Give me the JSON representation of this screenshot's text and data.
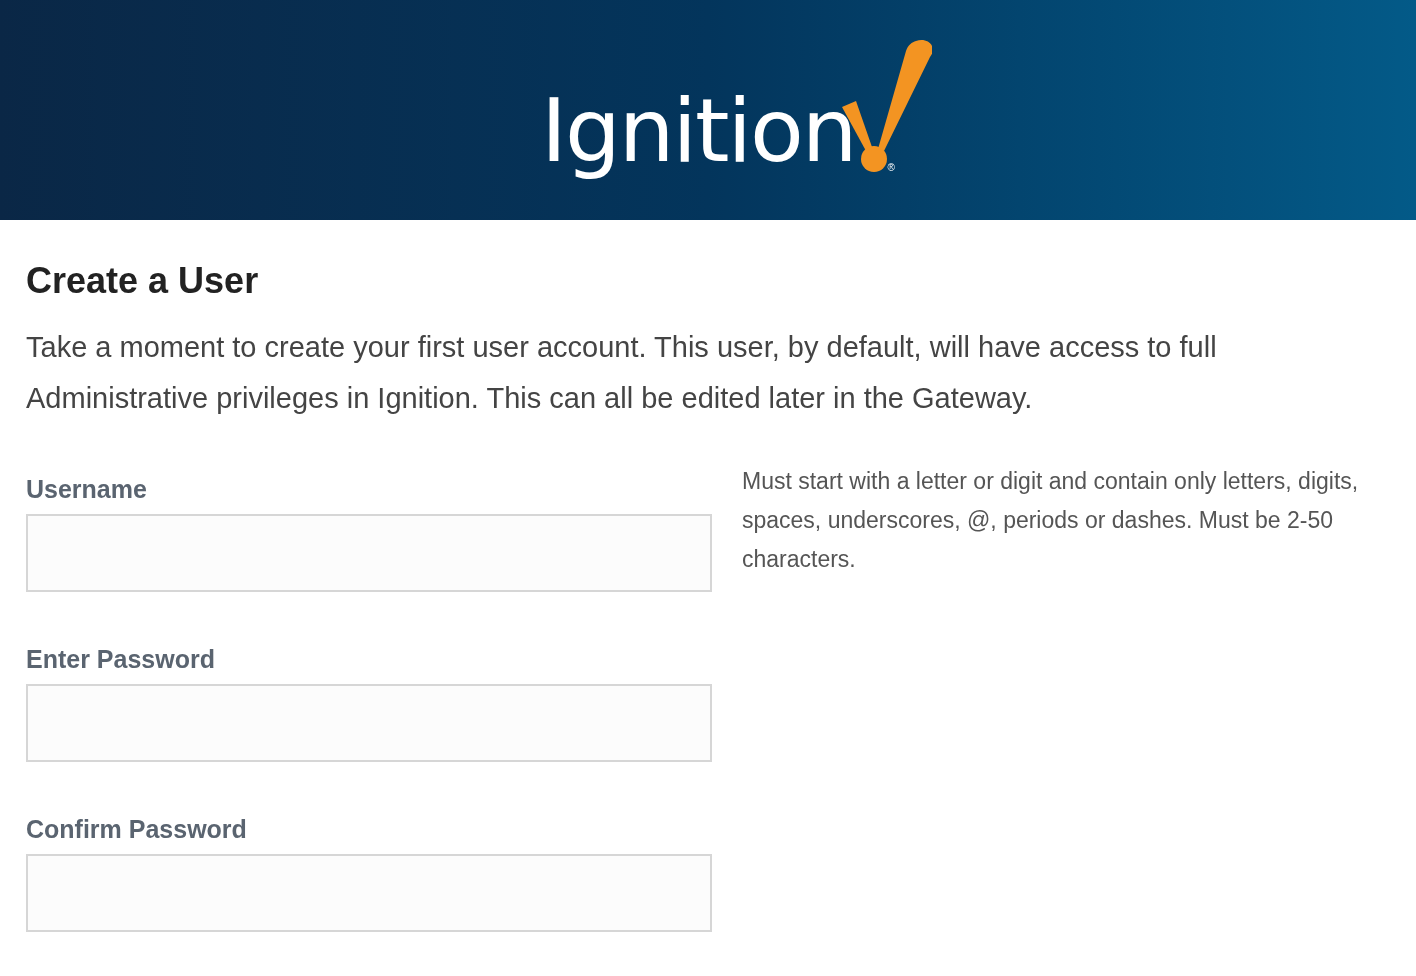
{
  "header": {
    "logo_text": "Ignition",
    "logo_mark": "®"
  },
  "title": "Create a User",
  "intro": "Take a moment to create your first user account. This user, by default, will have access to full Administrative privileges in Ignition. This can all be edited later in the Gateway.",
  "fields": [
    {
      "label": "Username",
      "hint": "Must start with a letter or digit and contain only letters, digits, spaces, underscores, @, periods or dashes. Must be 2-50 characters."
    },
    {
      "label": "Enter Password"
    },
    {
      "label": "Confirm Password"
    }
  ]
}
